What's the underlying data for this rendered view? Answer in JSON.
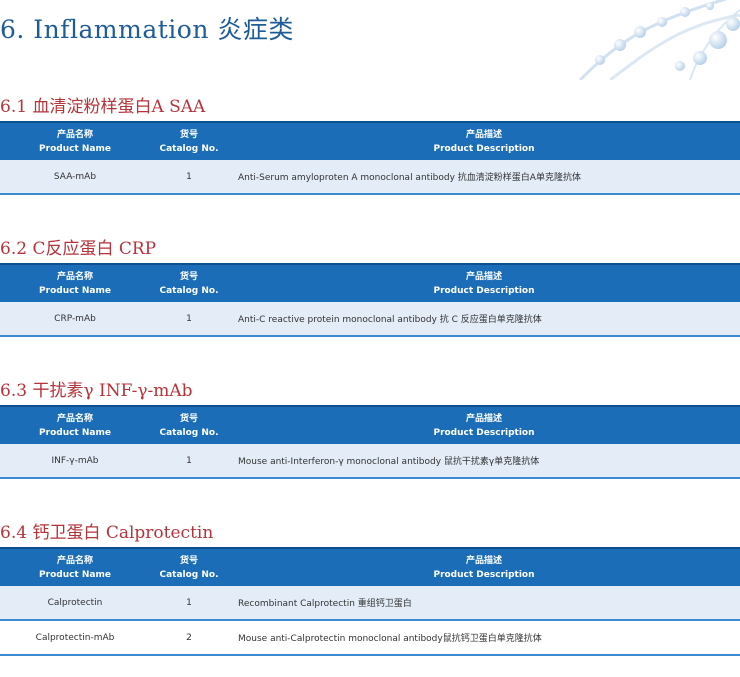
{
  "page_title": "6. Inflammation 炎症类",
  "table_header": {
    "name_cn": "产品名称",
    "name_en": "Product Name",
    "catalog_cn": "货号",
    "catalog_en": "Catalog No.",
    "desc_cn": "产品描述",
    "desc_en": "Product Description"
  },
  "sections": [
    {
      "title": "6.1 血清淀粉样蛋白A  SAA",
      "rows": [
        {
          "name": "SAA-mAb",
          "catalog": "1",
          "description": "Anti-Serum amyloproten A monoclonal antibody 抗血清淀粉样蛋白A单克隆抗体"
        }
      ]
    },
    {
      "title": "6.2 C反应蛋白  CRP",
      "rows": [
        {
          "name": "CRP-mAb",
          "catalog": "1",
          "description": "Anti-C reactive protein monoclonal antibody 抗 C 反应蛋白单克隆抗体"
        }
      ]
    },
    {
      "title": "6.3 干扰素γ  INF-γ-mAb",
      "rows": [
        {
          "name": "INF-γ-mAb",
          "catalog": "1",
          "description": "Mouse anti-Interferon-γ monoclonal antibody 鼠抗干扰素γ单克隆抗体"
        }
      ]
    },
    {
      "title": "6.4 钙卫蛋白 Calprotectin",
      "rows": [
        {
          "name": "Calprotectin",
          "catalog": "1",
          "description": "Recombinant Calprotectin 重组钙卫蛋白"
        },
        {
          "name": "Calprotectin-mAb",
          "catalog": "2",
          "description": "Mouse anti-Calprotectin monoclonal antibody鼠抗钙卫蛋白单克隆抗体"
        }
      ]
    }
  ]
}
